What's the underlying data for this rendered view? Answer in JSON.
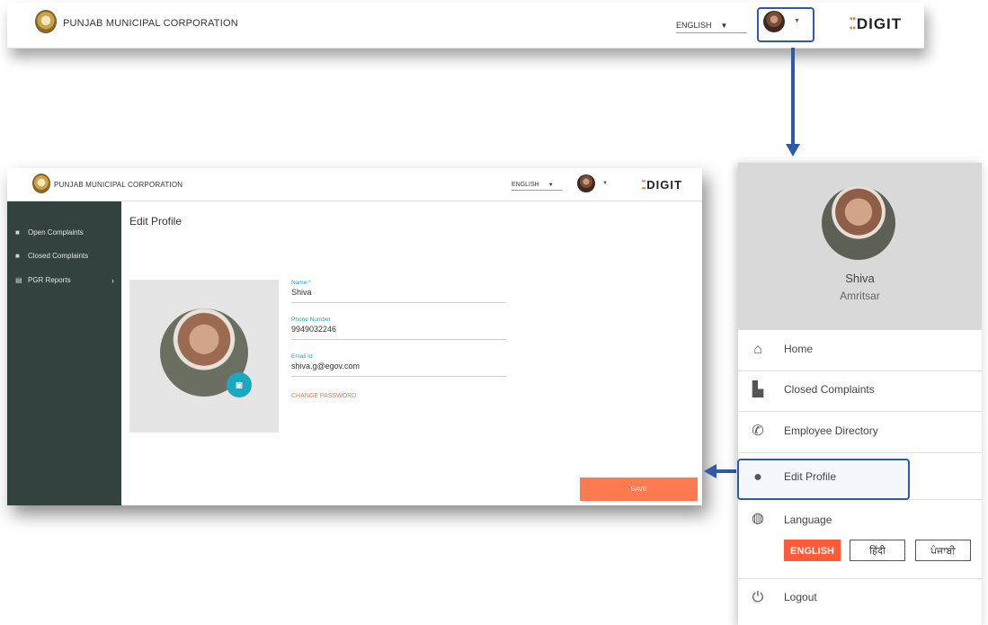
{
  "header": {
    "corporation_name": "PUNJAB MUNICIPAL CORPORATION",
    "language_selected": "ENGLISH",
    "brand": "DIGIT"
  },
  "sidebar": {
    "items": [
      {
        "label": "Open Complaints",
        "icon": "folder-icon"
      },
      {
        "label": "Closed Complaints",
        "icon": "folder-closed-icon"
      },
      {
        "label": "PGR Reports",
        "icon": "report-icon"
      }
    ]
  },
  "profile": {
    "title": "Edit Profile",
    "name_label": "Name *",
    "name_value": "Shiva",
    "phone_label": "Phone Number",
    "phone_value": "9949032246",
    "email_label": "Email Id",
    "email_value": "shiva.g@egov.com",
    "change_password": "CHANGE PASSWORD",
    "save_label": "SAVE"
  },
  "drawer": {
    "user_name": "Shiva",
    "user_city": "Amritsar",
    "menu": [
      {
        "label": "Home",
        "icon": "home-icon"
      },
      {
        "label": "Closed Complaints",
        "icon": "document-check-icon"
      },
      {
        "label": "Employee Directory",
        "icon": "phone-icon"
      },
      {
        "label": "Edit Profile",
        "icon": "person-icon"
      },
      {
        "label": "Language",
        "icon": "globe-icon"
      },
      {
        "label": "Logout",
        "icon": "power-icon"
      }
    ],
    "languages": [
      "ENGLISH",
      "हिंदी",
      "ਪੰਜਾਬੀ"
    ]
  },
  "colors": {
    "accent": "#fe7a51",
    "teal": "#1ba8bf",
    "sidebar_bg": "#33413f",
    "highlight": "#2f5aa8"
  }
}
